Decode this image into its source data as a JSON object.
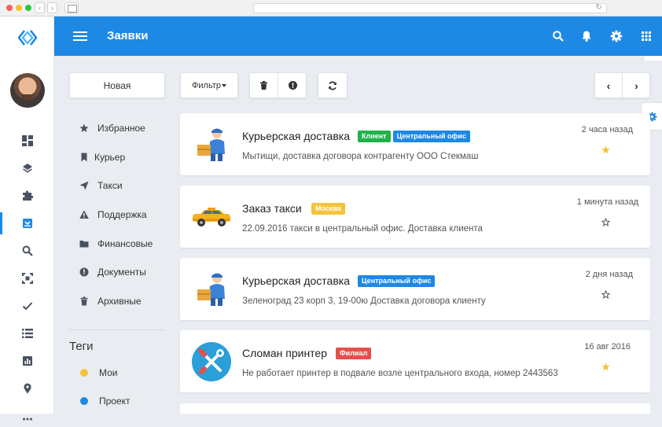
{
  "header": {
    "title": "Заявки"
  },
  "toolbar": {
    "new_label": "Новая",
    "filter_label": "Фильтр"
  },
  "folders": [
    {
      "label": "Избранное",
      "icon": "star-icon"
    },
    {
      "label": "Курьер",
      "icon": "bookmark-icon"
    },
    {
      "label": "Такси",
      "icon": "send-icon"
    },
    {
      "label": "Поддержка",
      "icon": "warning-icon"
    },
    {
      "label": "Финансовые",
      "icon": "folder-icon"
    },
    {
      "label": "Документы",
      "icon": "info-icon"
    },
    {
      "label": "Архивные",
      "icon": "trash-icon"
    }
  ],
  "tags": {
    "title": "Теги",
    "items": [
      {
        "label": "Мои",
        "color": "#f5c33b"
      },
      {
        "label": "Проект",
        "color": "#1e88e5"
      }
    ]
  },
  "requests": [
    {
      "title": "Курьерская доставка",
      "badges": [
        {
          "label": "Клиент",
          "color": "#21b24b"
        },
        {
          "label": "Центральный офис",
          "color": "#1e88e5"
        }
      ],
      "description": "Мытищи, доставка договора контрагенту ООО Стекмаш",
      "time": "2 часа назад",
      "starred": true,
      "icon": "courier-icon"
    },
    {
      "title": "Заказ такси",
      "badges": [
        {
          "label": "Москва",
          "color": "#f5c33b"
        }
      ],
      "description": "22.09.2016 такси в центральный офис. Доставка клиента",
      "time": "1 минута назад",
      "starred": false,
      "icon": "taxi-icon"
    },
    {
      "title": "Курьерская доставка",
      "badges": [
        {
          "label": "Центральный офис",
          "color": "#1e88e5"
        }
      ],
      "description": "Зеленоград 23 корп 3, 19-00ю Доставка договора клиенту",
      "time": "2 дня назад",
      "starred": false,
      "icon": "courier-icon"
    },
    {
      "title": "Сломан принтер",
      "badges": [
        {
          "label": "Филиал",
          "color": "#e84e4e"
        }
      ],
      "description": "Не работает принтер в подвале возле центрального входа, номер 2443563",
      "time": "16 авг 2016",
      "starred": true,
      "icon": "tools-icon"
    }
  ]
}
